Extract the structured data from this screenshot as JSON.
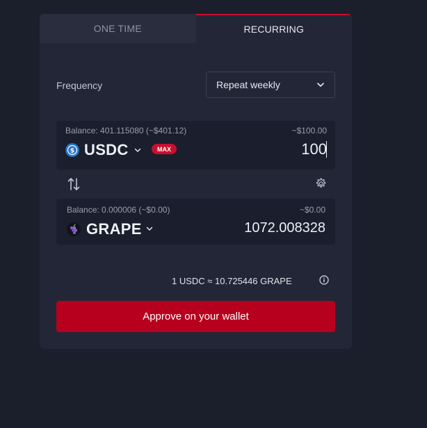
{
  "tabs": [
    {
      "label": "ONE TIME",
      "active": false
    },
    {
      "label": "RECURRING",
      "active": true
    }
  ],
  "frequency": {
    "label": "Frequency",
    "selected": "Repeat weekly"
  },
  "from": {
    "balance": "Balance: 401.115080 (~$401.12)",
    "usd_value": "~$100.00",
    "token": "USDC",
    "max_label": "MAX",
    "amount": "100"
  },
  "to": {
    "balance": "Balance: 0.000006 (~$0.00)",
    "usd_value": "~$0.00",
    "token": "GRAPE",
    "amount": "1072.008328"
  },
  "rate": "1 USDC ≈ 10.725446 GRAPE",
  "approve_label": "Approve on your wallet",
  "colors": {
    "accent": "#c8102e",
    "background": "#1b1e2b",
    "card": "#232636"
  },
  "icons": [
    "usdc-icon",
    "grape-icon",
    "chevron-down-icon",
    "swap-icon",
    "gear-icon",
    "info-icon"
  ]
}
